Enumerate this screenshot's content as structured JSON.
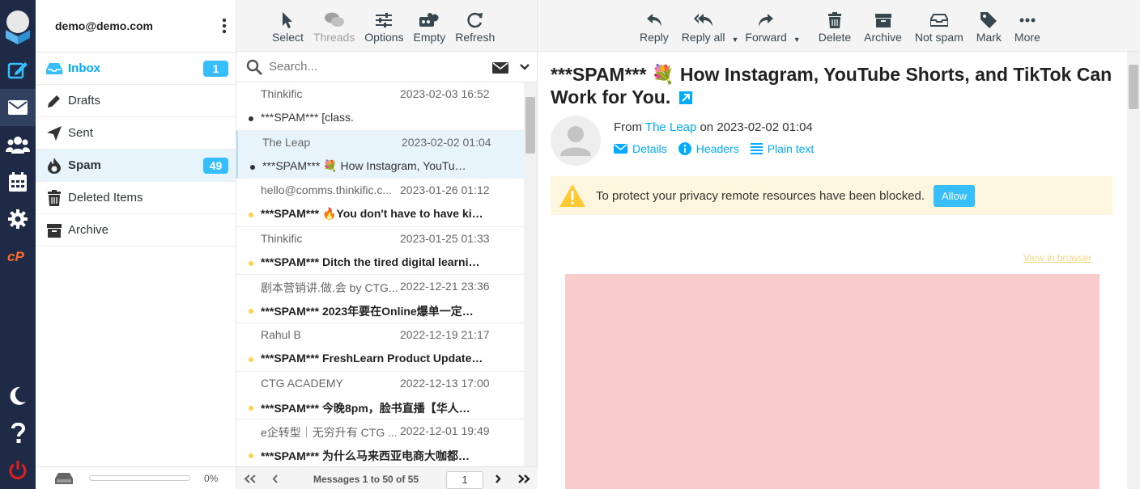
{
  "account": {
    "email": "demo@demo.com"
  },
  "rail": {
    "items": [
      "compose",
      "mail",
      "contacts",
      "calendar",
      "settings",
      "cpanel",
      "dark-mode",
      "help",
      "logout"
    ]
  },
  "folders": [
    {
      "name": "Inbox",
      "icon": "inbox-icon",
      "badge": "1"
    },
    {
      "name": "Drafts",
      "icon": "pencil-icon",
      "badge": ""
    },
    {
      "name": "Sent",
      "icon": "send-icon",
      "badge": ""
    },
    {
      "name": "Spam",
      "icon": "fire-icon",
      "badge": "49"
    },
    {
      "name": "Deleted Items",
      "icon": "trash-icon",
      "badge": ""
    },
    {
      "name": "Archive",
      "icon": "archive-icon",
      "badge": ""
    }
  ],
  "quota": {
    "percent_label": "0%",
    "used_fraction": 0
  },
  "list_toolbar": {
    "select": "Select",
    "threads": "Threads",
    "options": "Options",
    "empty": "Empty",
    "refresh": "Refresh"
  },
  "search": {
    "placeholder": "Search..."
  },
  "messages": [
    {
      "from": "Thinkific",
      "date": "2023-02-03 16:52",
      "subject": "***SPAM*** [class.",
      "unread": false,
      "selected": false
    },
    {
      "from": "The Leap",
      "date": "2023-02-02 01:04",
      "subject": "***SPAM*** 💐 How Instagram, YouTu…",
      "unread": false,
      "selected": true
    },
    {
      "from": "hello@comms.thinkific.c...",
      "date": "2023-01-26 01:12",
      "subject": "***SPAM*** 🔥You don't have to have ki…",
      "unread": true,
      "selected": false
    },
    {
      "from": "Thinkific",
      "date": "2023-01-25 01:33",
      "subject": "***SPAM*** Ditch the tired digital learni…",
      "unread": true,
      "selected": false
    },
    {
      "from": "剧本营销讲.做.会 by CTG...",
      "date": "2022-12-21 23:36",
      "subject": "***SPAM*** 2023年要在Online爆单一定…",
      "unread": true,
      "selected": false
    },
    {
      "from": "Rahul B",
      "date": "2022-12-19 21:17",
      "subject": "***SPAM*** FreshLearn Product Update…",
      "unread": true,
      "selected": false
    },
    {
      "from": "CTG ACADEMY",
      "date": "2022-12-13 17:00",
      "subject": "***SPAM*** 今晚8pm，脸书直播【华人…",
      "unread": true,
      "selected": false
    },
    {
      "from": "e企转型｜无穷升有 CTG ...",
      "date": "2022-12-01 19:49",
      "subject": "***SPAM*** 为什么马来西亚电商大咖都…",
      "unread": true,
      "selected": false
    }
  ],
  "pagination": {
    "label": "Messages 1 to 50 of 55",
    "page": "1"
  },
  "read_toolbar": {
    "reply": "Reply",
    "reply_all": "Reply all",
    "forward": "Forward",
    "delete": "Delete",
    "archive": "Archive",
    "not_spam": "Not spam",
    "mark": "Mark",
    "more": "More"
  },
  "email": {
    "subject": "***SPAM*** 💐 How Instagram, YouTube Shorts, and TikTok Can Work for You.",
    "from_prefix": "From",
    "from_name": "The Leap",
    "on": "on",
    "date": "2023-02-02 01:04",
    "details": "Details",
    "headers": "Headers",
    "plain_text": "Plain text",
    "warning": "To protect your privacy remote resources have been blocked.",
    "allow": "Allow",
    "view_in_browser": "View in browser"
  },
  "colors": {
    "accent": "#00acff",
    "badge": "#37beff",
    "rail": "#1f2b46",
    "warning_bg": "#fdf6de",
    "unread_dot": "#ffd24d"
  }
}
